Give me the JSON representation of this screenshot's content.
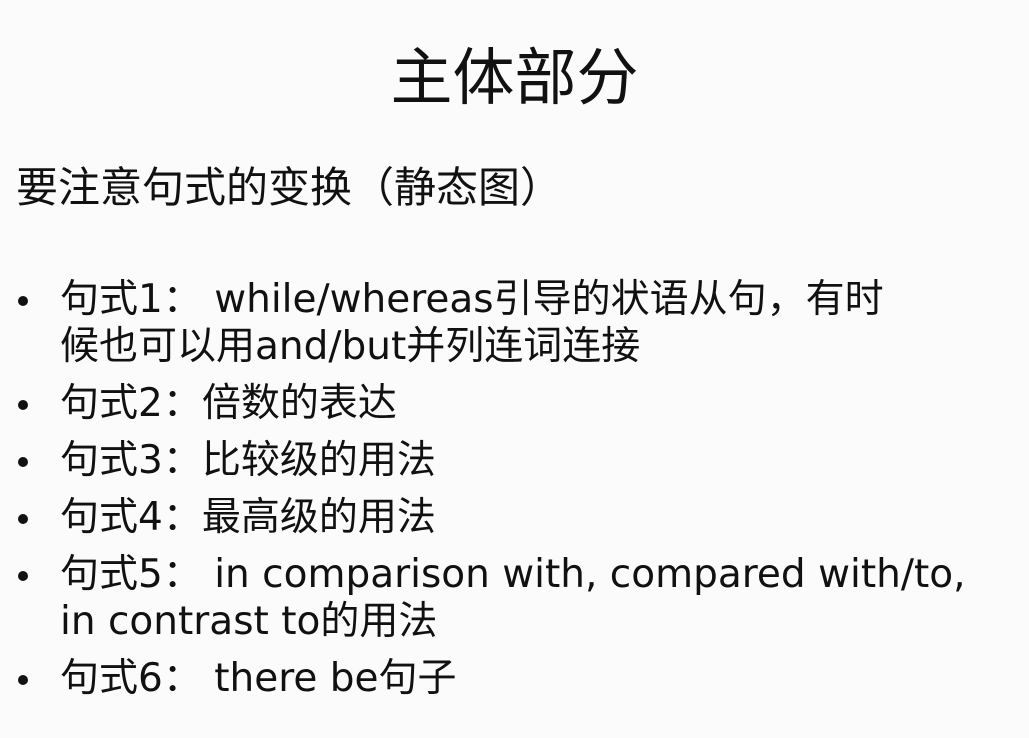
{
  "slide": {
    "title": "主体部分",
    "subheading": "要注意句式的变换（静态图）",
    "bullets": [
      {
        "lines": [
          "句式1： while/whereas引导的状语从句，有时",
          "候也可以用and/but并列连词连接"
        ]
      },
      {
        "lines": [
          "句式2：倍数的表达"
        ]
      },
      {
        "lines": [
          "句式3：比较级的用法"
        ]
      },
      {
        "lines": [
          "句式4：最高级的用法"
        ]
      },
      {
        "lines": [
          "句式5：  in comparison with, compared with/to,",
          "in contrast to的用法"
        ]
      },
      {
        "lines": [
          "句式6：  there be句子"
        ]
      }
    ]
  }
}
